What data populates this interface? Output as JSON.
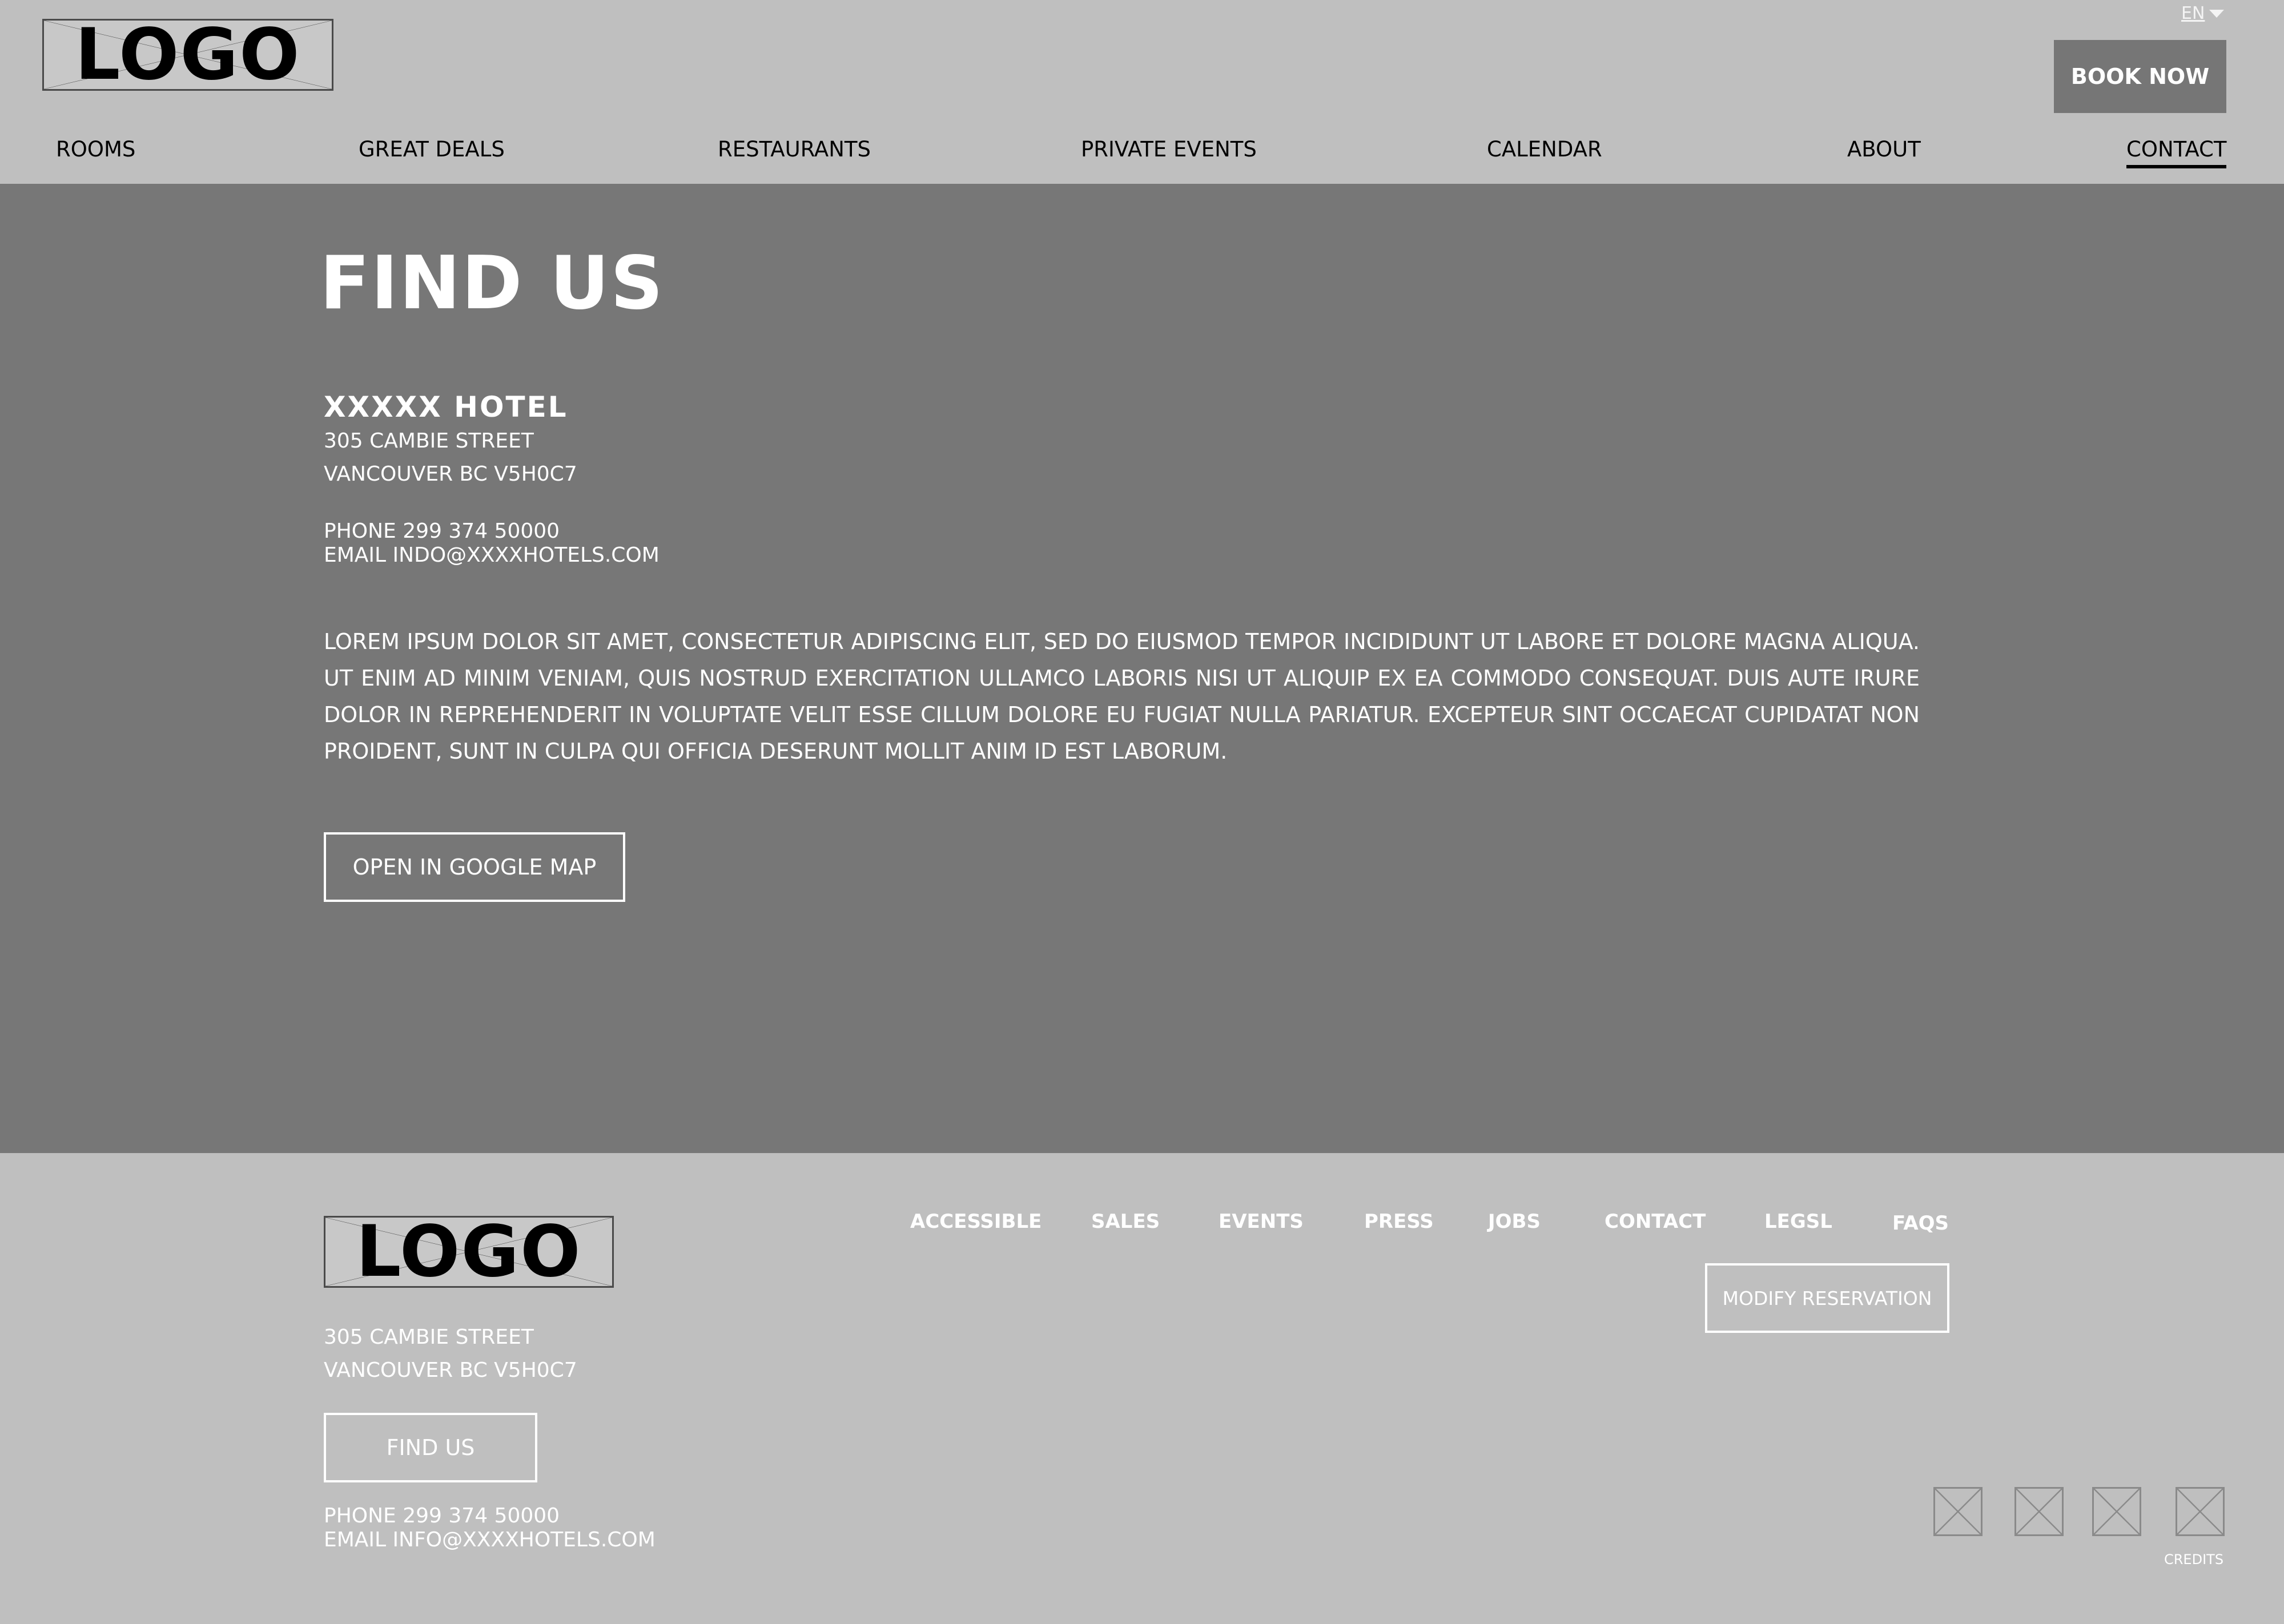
{
  "header": {
    "logo_text": "LOGO",
    "language": "EN",
    "book_now": "BOOK NOW",
    "nav": [
      "ROOMS",
      "GREAT  DEALS",
      "RESTAURANTS",
      "PRIVATE  EVENTS",
      "CALENDAR",
      "ABOUT",
      "CONTACT"
    ],
    "active_nav": "CONTACT"
  },
  "main": {
    "title": "FIND US",
    "hotel_name": "XXXXX  HOTEL",
    "street": "305 CAMBIE STREET",
    "city": "VANCOUVER BC V5H0C7",
    "phone": "PHONE 299 374 50000",
    "email": "EMAIL INDO@XXXXHOTELS.COM",
    "description": "LOREM IPSUM DOLOR SIT AMET, CONSECTETUR ADIPISCING ELIT, SED DO EIUSMOD TEMPOR INCIDIDUNT UT LABORE ET DOLORE MAGNA ALIQUA. UT ENIM AD MINIM VENIAM, QUIS NOSTRUD EXERCITATION ULLAMCO LABORIS NISI UT ALIQUIP EX EA COMMODO CONSEQUAT. DUIS AUTE IRURE DOLOR IN REPREHENDERIT IN VOLUPTATE VELIT ESSE CILLUM DOLORE EU FUGIAT NULLA PARIATUR. EXCEPTEUR SINT OCCAECAT CUPIDATAT NON PROIDENT, SUNT IN CULPA QUI OFFICIA DESERUNT MOLLIT ANIM ID EST LABORUM.",
    "map_button": "OPEN IN GOOGLE MAP"
  },
  "footer": {
    "logo_text": "LOGO",
    "street": "305 CAMBIE STREET",
    "city": "VANCOUVER BC V5H0C7",
    "find_us": "FIND US",
    "phone": "PHONE 299 374 50000",
    "email": "EMAIL INFO@XXXXHOTELS.COM",
    "links": [
      "ACCESSIBLE",
      "SALES",
      "EVENTS",
      "PRESS",
      "JOBS",
      "CONTACT",
      "LEGSL",
      "FAQS"
    ],
    "modify_reservation": "MODIFY RESERVATION",
    "social_icons": [
      "social-placeholder-icon",
      "social-placeholder-icon",
      "social-placeholder-icon",
      "social-placeholder-icon"
    ],
    "credits": "CREDITS"
  },
  "colors": {
    "header_bg": "#bfbfbf",
    "main_bg": "#777777",
    "button_bg": "#767676",
    "text_light": "#ffffff"
  }
}
